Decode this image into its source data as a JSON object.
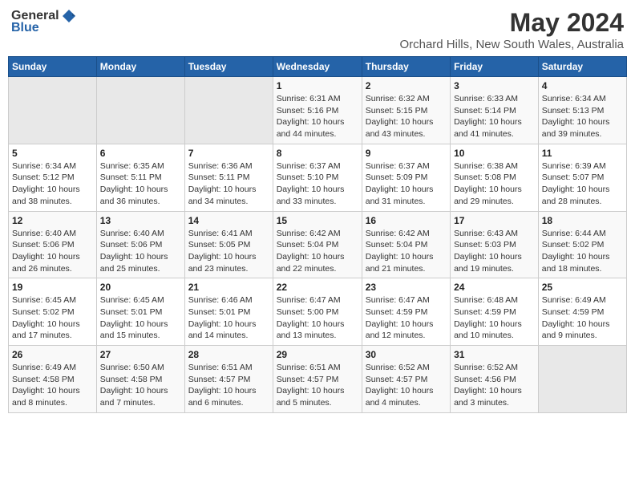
{
  "logo": {
    "text_general": "General",
    "text_blue": "Blue"
  },
  "title": "May 2024",
  "subtitle": "Orchard Hills, New South Wales, Australia",
  "days_of_week": [
    "Sunday",
    "Monday",
    "Tuesday",
    "Wednesday",
    "Thursday",
    "Friday",
    "Saturday"
  ],
  "weeks": [
    [
      {
        "day": "",
        "info": ""
      },
      {
        "day": "",
        "info": ""
      },
      {
        "day": "",
        "info": ""
      },
      {
        "day": "1",
        "info": "Sunrise: 6:31 AM\nSunset: 5:16 PM\nDaylight: 10 hours and 44 minutes."
      },
      {
        "day": "2",
        "info": "Sunrise: 6:32 AM\nSunset: 5:15 PM\nDaylight: 10 hours and 43 minutes."
      },
      {
        "day": "3",
        "info": "Sunrise: 6:33 AM\nSunset: 5:14 PM\nDaylight: 10 hours and 41 minutes."
      },
      {
        "day": "4",
        "info": "Sunrise: 6:34 AM\nSunset: 5:13 PM\nDaylight: 10 hours and 39 minutes."
      }
    ],
    [
      {
        "day": "5",
        "info": "Sunrise: 6:34 AM\nSunset: 5:12 PM\nDaylight: 10 hours and 38 minutes."
      },
      {
        "day": "6",
        "info": "Sunrise: 6:35 AM\nSunset: 5:11 PM\nDaylight: 10 hours and 36 minutes."
      },
      {
        "day": "7",
        "info": "Sunrise: 6:36 AM\nSunset: 5:11 PM\nDaylight: 10 hours and 34 minutes."
      },
      {
        "day": "8",
        "info": "Sunrise: 6:37 AM\nSunset: 5:10 PM\nDaylight: 10 hours and 33 minutes."
      },
      {
        "day": "9",
        "info": "Sunrise: 6:37 AM\nSunset: 5:09 PM\nDaylight: 10 hours and 31 minutes."
      },
      {
        "day": "10",
        "info": "Sunrise: 6:38 AM\nSunset: 5:08 PM\nDaylight: 10 hours and 29 minutes."
      },
      {
        "day": "11",
        "info": "Sunrise: 6:39 AM\nSunset: 5:07 PM\nDaylight: 10 hours and 28 minutes."
      }
    ],
    [
      {
        "day": "12",
        "info": "Sunrise: 6:40 AM\nSunset: 5:06 PM\nDaylight: 10 hours and 26 minutes."
      },
      {
        "day": "13",
        "info": "Sunrise: 6:40 AM\nSunset: 5:06 PM\nDaylight: 10 hours and 25 minutes."
      },
      {
        "day": "14",
        "info": "Sunrise: 6:41 AM\nSunset: 5:05 PM\nDaylight: 10 hours and 23 minutes."
      },
      {
        "day": "15",
        "info": "Sunrise: 6:42 AM\nSunset: 5:04 PM\nDaylight: 10 hours and 22 minutes."
      },
      {
        "day": "16",
        "info": "Sunrise: 6:42 AM\nSunset: 5:04 PM\nDaylight: 10 hours and 21 minutes."
      },
      {
        "day": "17",
        "info": "Sunrise: 6:43 AM\nSunset: 5:03 PM\nDaylight: 10 hours and 19 minutes."
      },
      {
        "day": "18",
        "info": "Sunrise: 6:44 AM\nSunset: 5:02 PM\nDaylight: 10 hours and 18 minutes."
      }
    ],
    [
      {
        "day": "19",
        "info": "Sunrise: 6:45 AM\nSunset: 5:02 PM\nDaylight: 10 hours and 17 minutes."
      },
      {
        "day": "20",
        "info": "Sunrise: 6:45 AM\nSunset: 5:01 PM\nDaylight: 10 hours and 15 minutes."
      },
      {
        "day": "21",
        "info": "Sunrise: 6:46 AM\nSunset: 5:01 PM\nDaylight: 10 hours and 14 minutes."
      },
      {
        "day": "22",
        "info": "Sunrise: 6:47 AM\nSunset: 5:00 PM\nDaylight: 10 hours and 13 minutes."
      },
      {
        "day": "23",
        "info": "Sunrise: 6:47 AM\nSunset: 4:59 PM\nDaylight: 10 hours and 12 minutes."
      },
      {
        "day": "24",
        "info": "Sunrise: 6:48 AM\nSunset: 4:59 PM\nDaylight: 10 hours and 10 minutes."
      },
      {
        "day": "25",
        "info": "Sunrise: 6:49 AM\nSunset: 4:59 PM\nDaylight: 10 hours and 9 minutes."
      }
    ],
    [
      {
        "day": "26",
        "info": "Sunrise: 6:49 AM\nSunset: 4:58 PM\nDaylight: 10 hours and 8 minutes."
      },
      {
        "day": "27",
        "info": "Sunrise: 6:50 AM\nSunset: 4:58 PM\nDaylight: 10 hours and 7 minutes."
      },
      {
        "day": "28",
        "info": "Sunrise: 6:51 AM\nSunset: 4:57 PM\nDaylight: 10 hours and 6 minutes."
      },
      {
        "day": "29",
        "info": "Sunrise: 6:51 AM\nSunset: 4:57 PM\nDaylight: 10 hours and 5 minutes."
      },
      {
        "day": "30",
        "info": "Sunrise: 6:52 AM\nSunset: 4:57 PM\nDaylight: 10 hours and 4 minutes."
      },
      {
        "day": "31",
        "info": "Sunrise: 6:52 AM\nSunset: 4:56 PM\nDaylight: 10 hours and 3 minutes."
      },
      {
        "day": "",
        "info": ""
      }
    ]
  ]
}
